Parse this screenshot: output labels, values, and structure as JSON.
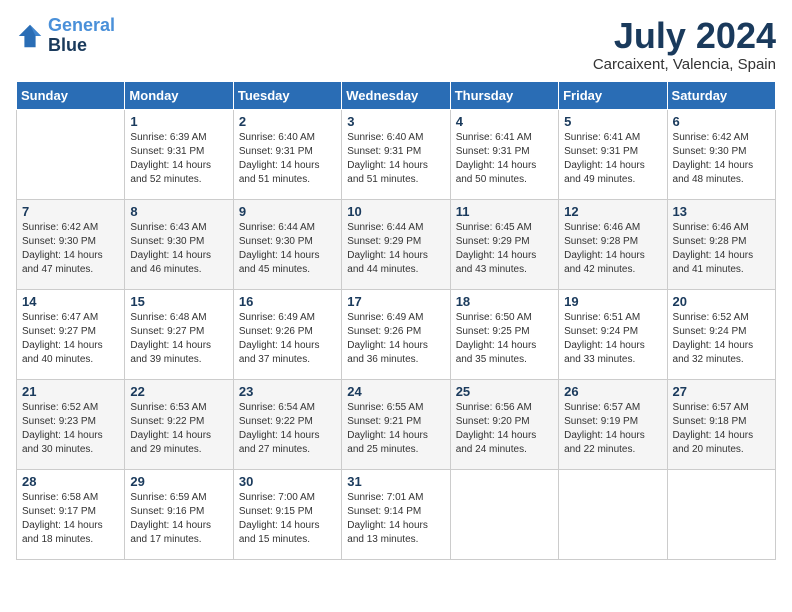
{
  "logo": {
    "line1": "General",
    "line2": "Blue"
  },
  "title": "July 2024",
  "location": "Carcaixent, Valencia, Spain",
  "weekdays": [
    "Sunday",
    "Monday",
    "Tuesday",
    "Wednesday",
    "Thursday",
    "Friday",
    "Saturday"
  ],
  "weeks": [
    [
      {
        "day": "",
        "sunrise": "",
        "sunset": "",
        "daylight": ""
      },
      {
        "day": "1",
        "sunrise": "Sunrise: 6:39 AM",
        "sunset": "Sunset: 9:31 PM",
        "daylight": "Daylight: 14 hours and 52 minutes."
      },
      {
        "day": "2",
        "sunrise": "Sunrise: 6:40 AM",
        "sunset": "Sunset: 9:31 PM",
        "daylight": "Daylight: 14 hours and 51 minutes."
      },
      {
        "day": "3",
        "sunrise": "Sunrise: 6:40 AM",
        "sunset": "Sunset: 9:31 PM",
        "daylight": "Daylight: 14 hours and 51 minutes."
      },
      {
        "day": "4",
        "sunrise": "Sunrise: 6:41 AM",
        "sunset": "Sunset: 9:31 PM",
        "daylight": "Daylight: 14 hours and 50 minutes."
      },
      {
        "day": "5",
        "sunrise": "Sunrise: 6:41 AM",
        "sunset": "Sunset: 9:31 PM",
        "daylight": "Daylight: 14 hours and 49 minutes."
      },
      {
        "day": "6",
        "sunrise": "Sunrise: 6:42 AM",
        "sunset": "Sunset: 9:30 PM",
        "daylight": "Daylight: 14 hours and 48 minutes."
      }
    ],
    [
      {
        "day": "7",
        "sunrise": "Sunrise: 6:42 AM",
        "sunset": "Sunset: 9:30 PM",
        "daylight": "Daylight: 14 hours and 47 minutes."
      },
      {
        "day": "8",
        "sunrise": "Sunrise: 6:43 AM",
        "sunset": "Sunset: 9:30 PM",
        "daylight": "Daylight: 14 hours and 46 minutes."
      },
      {
        "day": "9",
        "sunrise": "Sunrise: 6:44 AM",
        "sunset": "Sunset: 9:30 PM",
        "daylight": "Daylight: 14 hours and 45 minutes."
      },
      {
        "day": "10",
        "sunrise": "Sunrise: 6:44 AM",
        "sunset": "Sunset: 9:29 PM",
        "daylight": "Daylight: 14 hours and 44 minutes."
      },
      {
        "day": "11",
        "sunrise": "Sunrise: 6:45 AM",
        "sunset": "Sunset: 9:29 PM",
        "daylight": "Daylight: 14 hours and 43 minutes."
      },
      {
        "day": "12",
        "sunrise": "Sunrise: 6:46 AM",
        "sunset": "Sunset: 9:28 PM",
        "daylight": "Daylight: 14 hours and 42 minutes."
      },
      {
        "day": "13",
        "sunrise": "Sunrise: 6:46 AM",
        "sunset": "Sunset: 9:28 PM",
        "daylight": "Daylight: 14 hours and 41 minutes."
      }
    ],
    [
      {
        "day": "14",
        "sunrise": "Sunrise: 6:47 AM",
        "sunset": "Sunset: 9:27 PM",
        "daylight": "Daylight: 14 hours and 40 minutes."
      },
      {
        "day": "15",
        "sunrise": "Sunrise: 6:48 AM",
        "sunset": "Sunset: 9:27 PM",
        "daylight": "Daylight: 14 hours and 39 minutes."
      },
      {
        "day": "16",
        "sunrise": "Sunrise: 6:49 AM",
        "sunset": "Sunset: 9:26 PM",
        "daylight": "Daylight: 14 hours and 37 minutes."
      },
      {
        "day": "17",
        "sunrise": "Sunrise: 6:49 AM",
        "sunset": "Sunset: 9:26 PM",
        "daylight": "Daylight: 14 hours and 36 minutes."
      },
      {
        "day": "18",
        "sunrise": "Sunrise: 6:50 AM",
        "sunset": "Sunset: 9:25 PM",
        "daylight": "Daylight: 14 hours and 35 minutes."
      },
      {
        "day": "19",
        "sunrise": "Sunrise: 6:51 AM",
        "sunset": "Sunset: 9:24 PM",
        "daylight": "Daylight: 14 hours and 33 minutes."
      },
      {
        "day": "20",
        "sunrise": "Sunrise: 6:52 AM",
        "sunset": "Sunset: 9:24 PM",
        "daylight": "Daylight: 14 hours and 32 minutes."
      }
    ],
    [
      {
        "day": "21",
        "sunrise": "Sunrise: 6:52 AM",
        "sunset": "Sunset: 9:23 PM",
        "daylight": "Daylight: 14 hours and 30 minutes."
      },
      {
        "day": "22",
        "sunrise": "Sunrise: 6:53 AM",
        "sunset": "Sunset: 9:22 PM",
        "daylight": "Daylight: 14 hours and 29 minutes."
      },
      {
        "day": "23",
        "sunrise": "Sunrise: 6:54 AM",
        "sunset": "Sunset: 9:22 PM",
        "daylight": "Daylight: 14 hours and 27 minutes."
      },
      {
        "day": "24",
        "sunrise": "Sunrise: 6:55 AM",
        "sunset": "Sunset: 9:21 PM",
        "daylight": "Daylight: 14 hours and 25 minutes."
      },
      {
        "day": "25",
        "sunrise": "Sunrise: 6:56 AM",
        "sunset": "Sunset: 9:20 PM",
        "daylight": "Daylight: 14 hours and 24 minutes."
      },
      {
        "day": "26",
        "sunrise": "Sunrise: 6:57 AM",
        "sunset": "Sunset: 9:19 PM",
        "daylight": "Daylight: 14 hours and 22 minutes."
      },
      {
        "day": "27",
        "sunrise": "Sunrise: 6:57 AM",
        "sunset": "Sunset: 9:18 PM",
        "daylight": "Daylight: 14 hours and 20 minutes."
      }
    ],
    [
      {
        "day": "28",
        "sunrise": "Sunrise: 6:58 AM",
        "sunset": "Sunset: 9:17 PM",
        "daylight": "Daylight: 14 hours and 18 minutes."
      },
      {
        "day": "29",
        "sunrise": "Sunrise: 6:59 AM",
        "sunset": "Sunset: 9:16 PM",
        "daylight": "Daylight: 14 hours and 17 minutes."
      },
      {
        "day": "30",
        "sunrise": "Sunrise: 7:00 AM",
        "sunset": "Sunset: 9:15 PM",
        "daylight": "Daylight: 14 hours and 15 minutes."
      },
      {
        "day": "31",
        "sunrise": "Sunrise: 7:01 AM",
        "sunset": "Sunset: 9:14 PM",
        "daylight": "Daylight: 14 hours and 13 minutes."
      },
      {
        "day": "",
        "sunrise": "",
        "sunset": "",
        "daylight": ""
      },
      {
        "day": "",
        "sunrise": "",
        "sunset": "",
        "daylight": ""
      },
      {
        "day": "",
        "sunrise": "",
        "sunset": "",
        "daylight": ""
      }
    ]
  ]
}
